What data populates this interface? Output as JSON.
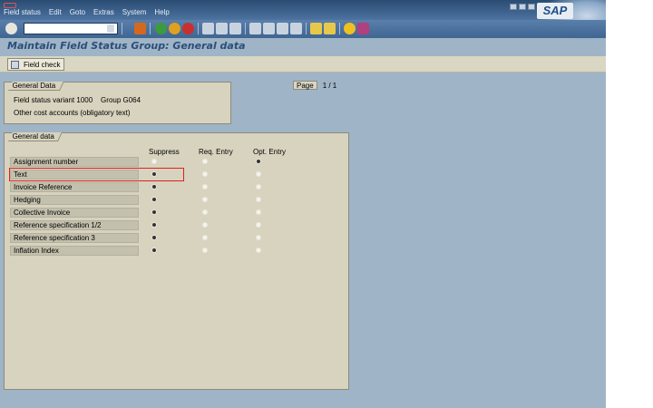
{
  "menu": [
    "Field status",
    "Edit",
    "Goto",
    "Extras",
    "System",
    "Help"
  ],
  "sap_logo": "SAP",
  "title": "Maintain Field Status Group: General data",
  "app_toolbar": {
    "field_check": "Field check"
  },
  "page_indicator": {
    "label": "Page",
    "value": "1 / 1"
  },
  "general_data_box": {
    "title": "General Data",
    "line1": "Field status variant 1000    Group G064",
    "line2": "Other cost accounts (obligatory text)"
  },
  "field_box": {
    "title": "General data",
    "columns": [
      "Suppress",
      "Req. Entry",
      "Opt. Entry"
    ],
    "rows": [
      {
        "label": "Assignment number",
        "selected": "Opt. Entry"
      },
      {
        "label": "Text",
        "selected": "Suppress"
      },
      {
        "label": "Invoice Reference",
        "selected": "Suppress"
      },
      {
        "label": "Hedging",
        "selected": "Suppress"
      },
      {
        "label": "Collective Invoice",
        "selected": "Suppress"
      },
      {
        "label": "Reference specification 1/2",
        "selected": "Suppress"
      },
      {
        "label": "Reference specification 3",
        "selected": "Suppress"
      },
      {
        "label": "Inflation Index",
        "selected": "Suppress"
      }
    ]
  }
}
